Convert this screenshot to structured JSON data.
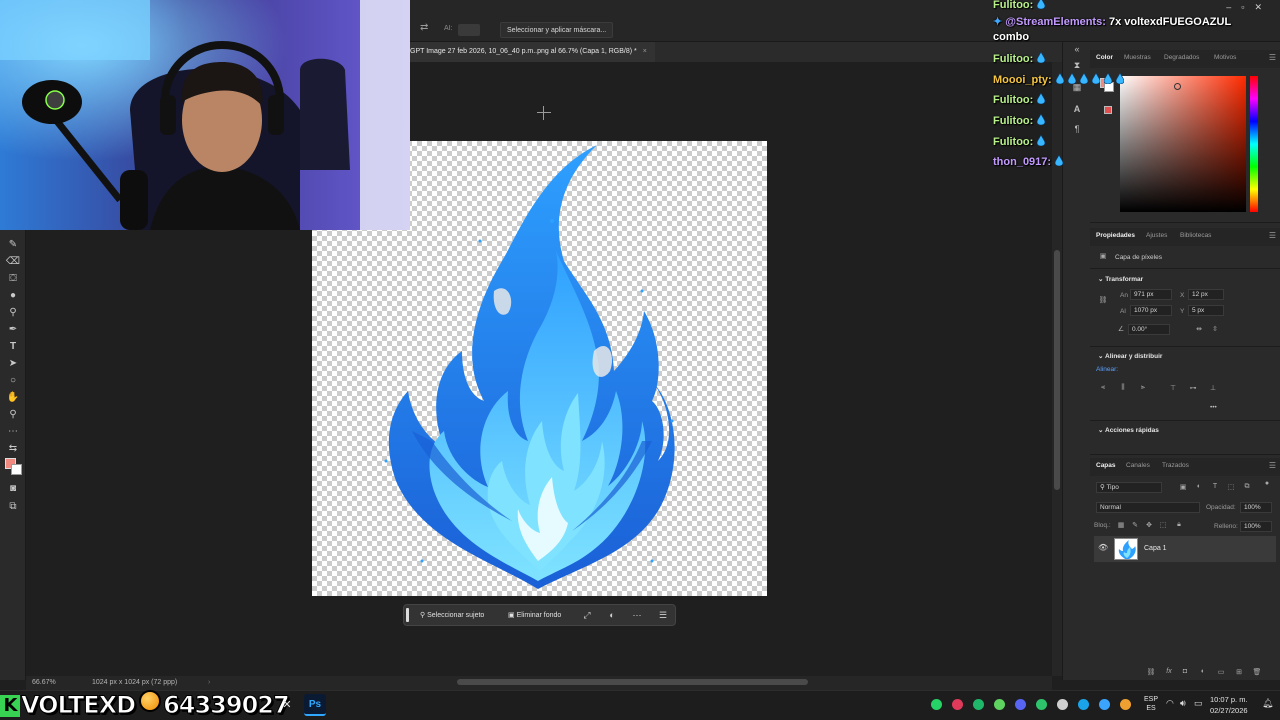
{
  "options_bar": {
    "al_label": "AI:",
    "select_mask_button": "Seleccionar y aplicar máscara..."
  },
  "document": {
    "tab_title": "GPT Image 27 feb 2026, 10_06_40 p.m..png al 66.7% (Capa 1, RGB/8) *",
    "close_glyph": "×"
  },
  "context_bar": {
    "select_subject": "Seleccionar sujeto",
    "remove_background": "Eliminar fondo"
  },
  "status_bar": {
    "zoom": "66.67%",
    "doc_info": "1024 px x 1024 px (72 ppp)"
  },
  "chat": [
    {
      "user": "Fulitoo:",
      "message": "",
      "color": "#b8f08a",
      "drops": 1
    },
    {
      "user": "",
      "message": "@StreamElements: 7x voltexdFUEGOAZUL",
      "color": "#ffffff",
      "mention_color": "#c39bff",
      "drops": 0
    },
    {
      "user": "",
      "message": "combo",
      "color": "#ffffff",
      "drops": 0
    },
    {
      "user": "Fulitoo:",
      "message": "",
      "color": "#b8f08a",
      "drops": 1
    },
    {
      "user": "Moooi_pty:",
      "message": "",
      "color": "#f5c542",
      "drops": 6
    },
    {
      "user": "Fulitoo:",
      "message": "",
      "color": "#b8f08a",
      "drops": 1
    },
    {
      "user": "Fulitoo:",
      "message": "",
      "color": "#b8f08a",
      "drops": 1
    },
    {
      "user": "Fulitoo:",
      "message": "",
      "color": "#b8f08a",
      "drops": 1
    },
    {
      "user": "thon_0917:",
      "message": "",
      "color": "#c39bff",
      "drops": 1
    }
  ],
  "color_panel": {
    "tabs": [
      "Color",
      "Muestras",
      "Degradados",
      "Motivos"
    ],
    "active": "Color",
    "foreground": "#f08a80",
    "background": "#ffffff"
  },
  "properties_panel": {
    "tabs": [
      "Propiedades",
      "Ajustes",
      "Bibliotecas"
    ],
    "layer_kind": "Capa de píxeles",
    "transform_heading": "Transformar",
    "width_label": "An",
    "width_value": "971 px",
    "height_label": "Al",
    "height_value": "1070 px",
    "x_label": "X",
    "x_value": "12 px",
    "y_label": "Y",
    "y_value": "5 px",
    "angle_value": "0.00°",
    "align_heading": "Alinear y distribuir",
    "align_label": "Alinear:",
    "quick_actions_heading": "Acciones rápidas",
    "more_glyph": "•••"
  },
  "layers_panel": {
    "tabs": [
      "Capas",
      "Canales",
      "Trazados"
    ],
    "filter": "Tipo",
    "blend_mode": "Normal",
    "opacity_label": "Opacidad:",
    "opacity_value": "100%",
    "lock_label": "Bloq.:",
    "fill_label": "Relleno:",
    "fill_value": "100%",
    "layer_name": "Capa 1"
  },
  "overlay": {
    "brand_name": "VOLTEXD",
    "brand_number": "64339027"
  },
  "taskbar": {
    "lang_top": "ESP",
    "lang_bottom": "ES",
    "time": "10:07 p. m.",
    "date": "02/27/2026",
    "ps_label": "Ps"
  },
  "colors": {
    "flame_dark": "#1a5fd6",
    "flame_mid": "#2ea0ff",
    "flame_light": "#7fe3ff",
    "flame_core": "#e6fbff"
  }
}
